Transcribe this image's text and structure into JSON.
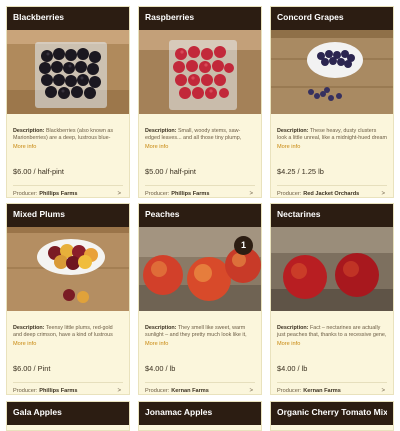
{
  "products": [
    {
      "title": "Blackberries",
      "description_label": "Description:",
      "description": "Blackberries (also known as Marionberries) are a deep, lustrous blue-black, shining and soft. They're one of the",
      "more_info": "More info",
      "price": "$6.00 / half-pint",
      "producer_label": "Producer:",
      "producer": "Phillips Farms",
      "arrow": ">"
    },
    {
      "title": "Raspberries",
      "description_label": "Description:",
      "description": "Small, woody stems, saw-edged leaves... and all those tiny plump, crimson spheres collected together into one",
      "more_info": "More info",
      "price": "$5.00 / half-pint",
      "producer_label": "Producer:",
      "producer": "Phillips Farms",
      "arrow": ">"
    },
    {
      "title": "Concord Grapes",
      "description_label": "Description:",
      "description": "These heavy, dusty clusters look a little unreal, like a midnight-hued dream of grapes. Concords are derived from \"fox",
      "more_info": "More info",
      "price": "$4.25 / 1.25 lb",
      "producer_label": "Producer:",
      "producer": "Red Jacket Orchards",
      "arrow": ">"
    },
    {
      "title": "Mixed Plums",
      "description_label": "Description:",
      "description": "Teensy little plums, red-gold and deep crimson, have a kind of lustrous sheen to them, sitting out in a bowl on your table.",
      "more_info": "More info",
      "price": "$6.00 / Pint",
      "producer_label": "Producer:",
      "producer": "Phillips Farms",
      "arrow": ">"
    },
    {
      "title": "Peaches",
      "badge": "1",
      "description_label": "Description:",
      "description": "They smell like sweet, warm sunlight – and they pretty much look like it, too. Perfectly ripe peaches are far and away",
      "more_info": "More info",
      "price": "$4.00 / lb",
      "producer_label": "Producer:",
      "producer": "Kernan Farms",
      "arrow": ">"
    },
    {
      "title": "Nectarines",
      "description_label": "Description:",
      "description": "Fact – nectarines are actually just peaches that, thanks to a recessive gene, never developed that characteristic fuzz. They",
      "more_info": "More info",
      "price": "$4.00 / lb",
      "producer_label": "Producer:",
      "producer": "Kernan Farms",
      "arrow": ">"
    },
    {
      "title": "Gala Apples"
    },
    {
      "title": "Jonamac Apples"
    },
    {
      "title": "Organic Cherry Tomato Mix"
    }
  ]
}
